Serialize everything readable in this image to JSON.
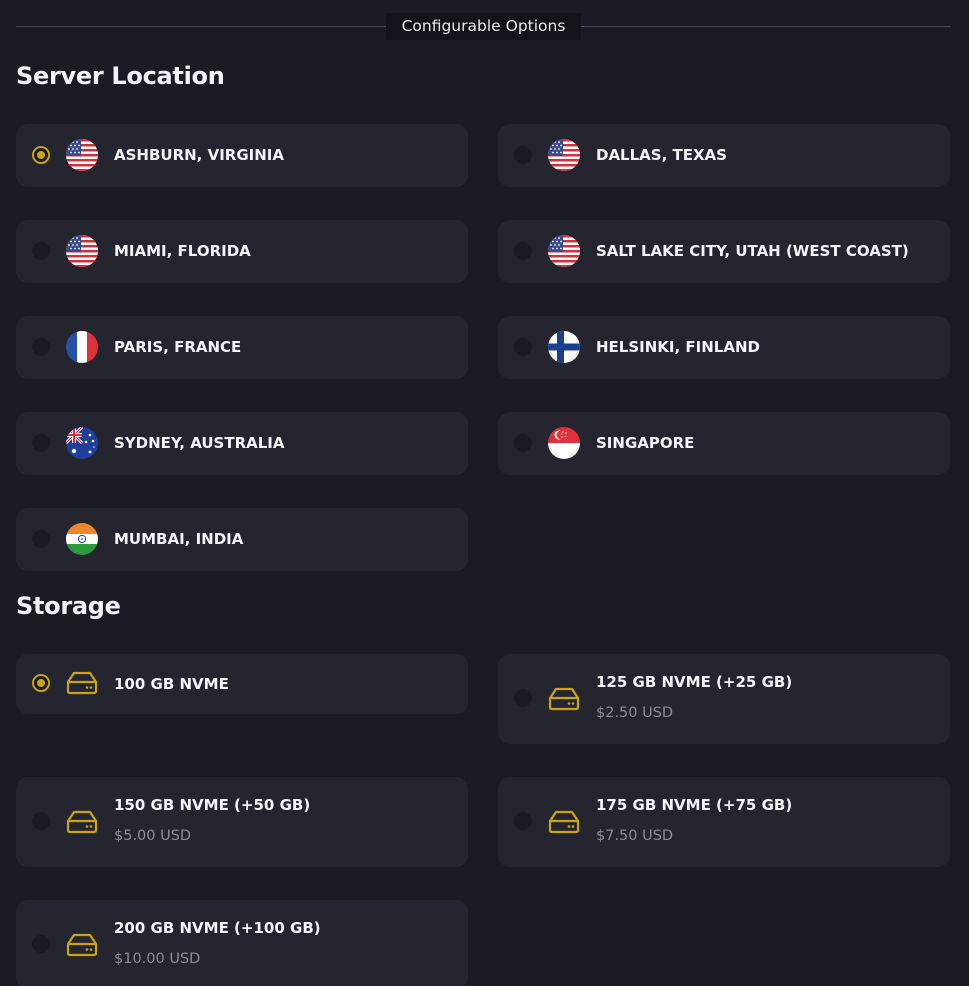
{
  "header": {
    "label": "Configurable Options"
  },
  "server_location": {
    "title": "Server Location",
    "options": [
      {
        "label": "ASHBURN, VIRGINIA",
        "flag": "us-flag-icon",
        "selected": true
      },
      {
        "label": "DALLAS, TEXAS",
        "flag": "us-flag-icon",
        "selected": false
      },
      {
        "label": "MIAMI, FLORIDA",
        "flag": "us-flag-icon",
        "selected": false
      },
      {
        "label": "SALT LAKE CITY, UTAH (WEST COAST)",
        "flag": "us-flag-icon",
        "selected": false
      },
      {
        "label": "PARIS, FRANCE",
        "flag": "france-flag-icon",
        "selected": false
      },
      {
        "label": "HELSINKI, FINLAND",
        "flag": "finland-flag-icon",
        "selected": false
      },
      {
        "label": "SYDNEY, AUSTRALIA",
        "flag": "australia-flag-icon",
        "selected": false
      },
      {
        "label": "SINGAPORE",
        "flag": "singapore-flag-icon",
        "selected": false
      },
      {
        "label": "MUMBAI, INDIA",
        "flag": "india-flag-icon",
        "selected": false
      }
    ]
  },
  "storage": {
    "title": "Storage",
    "options": [
      {
        "label": "100 GB NVME",
        "price": "",
        "selected": true
      },
      {
        "label": "125 GB NVME (+25 GB)",
        "price": "$2.50 USD",
        "selected": false
      },
      {
        "label": "150 GB NVME (+50 GB)",
        "price": "$5.00 USD",
        "selected": false
      },
      {
        "label": "175 GB NVME (+75 GB)",
        "price": "$7.50 USD",
        "selected": false
      },
      {
        "label": "200 GB NVME (+100 GB)",
        "price": "$10.00 USD",
        "selected": false
      }
    ]
  },
  "colors": {
    "accent": "#c9a414",
    "card": "#252530",
    "background": "#1b1b24",
    "muted_text": "#8c8c96"
  }
}
